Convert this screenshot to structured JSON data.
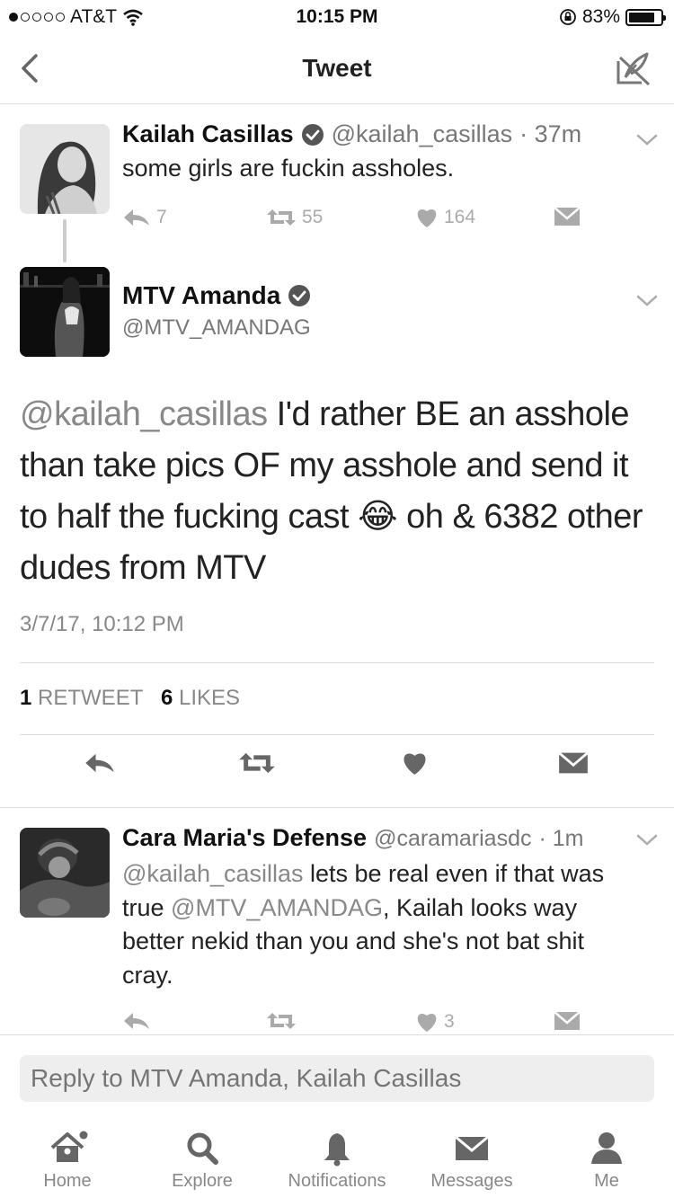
{
  "status_bar": {
    "carrier": "AT&T",
    "time": "10:15 PM",
    "battery": "83%",
    "battery_level": 0.83
  },
  "nav": {
    "title": "Tweet"
  },
  "parent_tweet": {
    "author_name": "Kailah Casillas",
    "handle": "@kailah_casillas",
    "time_ago": "· 37m",
    "text": "some girls are fuckin assholes.",
    "replies": "7",
    "retweets": "55",
    "likes": "164"
  },
  "main_tweet": {
    "author_name": "MTV Amanda",
    "handle": "@MTV_AMANDAG",
    "mention": "@kailah_casillas",
    "text": " I'd rather BE an asshole than take pics OF my asshole and send it to half the fucking cast 😂 oh & 6382 other dudes from MTV",
    "timestamp": "3/7/17, 10:12 PM",
    "retweet_count": "1",
    "retweet_label": "RETWEET",
    "like_count": "6",
    "like_label": "LIKES"
  },
  "reply_tweet": {
    "author_name": "Cara Maria's Defense",
    "handle": "@caramariasdc",
    "time_ago": "· 1m",
    "mention1": "@kailah_casillas",
    "text1": "  lets be real even if that was true ",
    "mention2": "@MTV_AMANDAG",
    "text2": ", Kailah looks way better nekid than you and she's not bat shit cray.",
    "likes": "3"
  },
  "reply_box": {
    "placeholder": "Reply to MTV Amanda, Kailah Casillas"
  },
  "tabs": [
    {
      "label": "Home",
      "icon": "home-icon"
    },
    {
      "label": "Explore",
      "icon": "search-icon"
    },
    {
      "label": "Notifications",
      "icon": "bell-icon"
    },
    {
      "label": "Messages",
      "icon": "envelope-icon"
    },
    {
      "label": "Me",
      "icon": "person-icon"
    }
  ]
}
